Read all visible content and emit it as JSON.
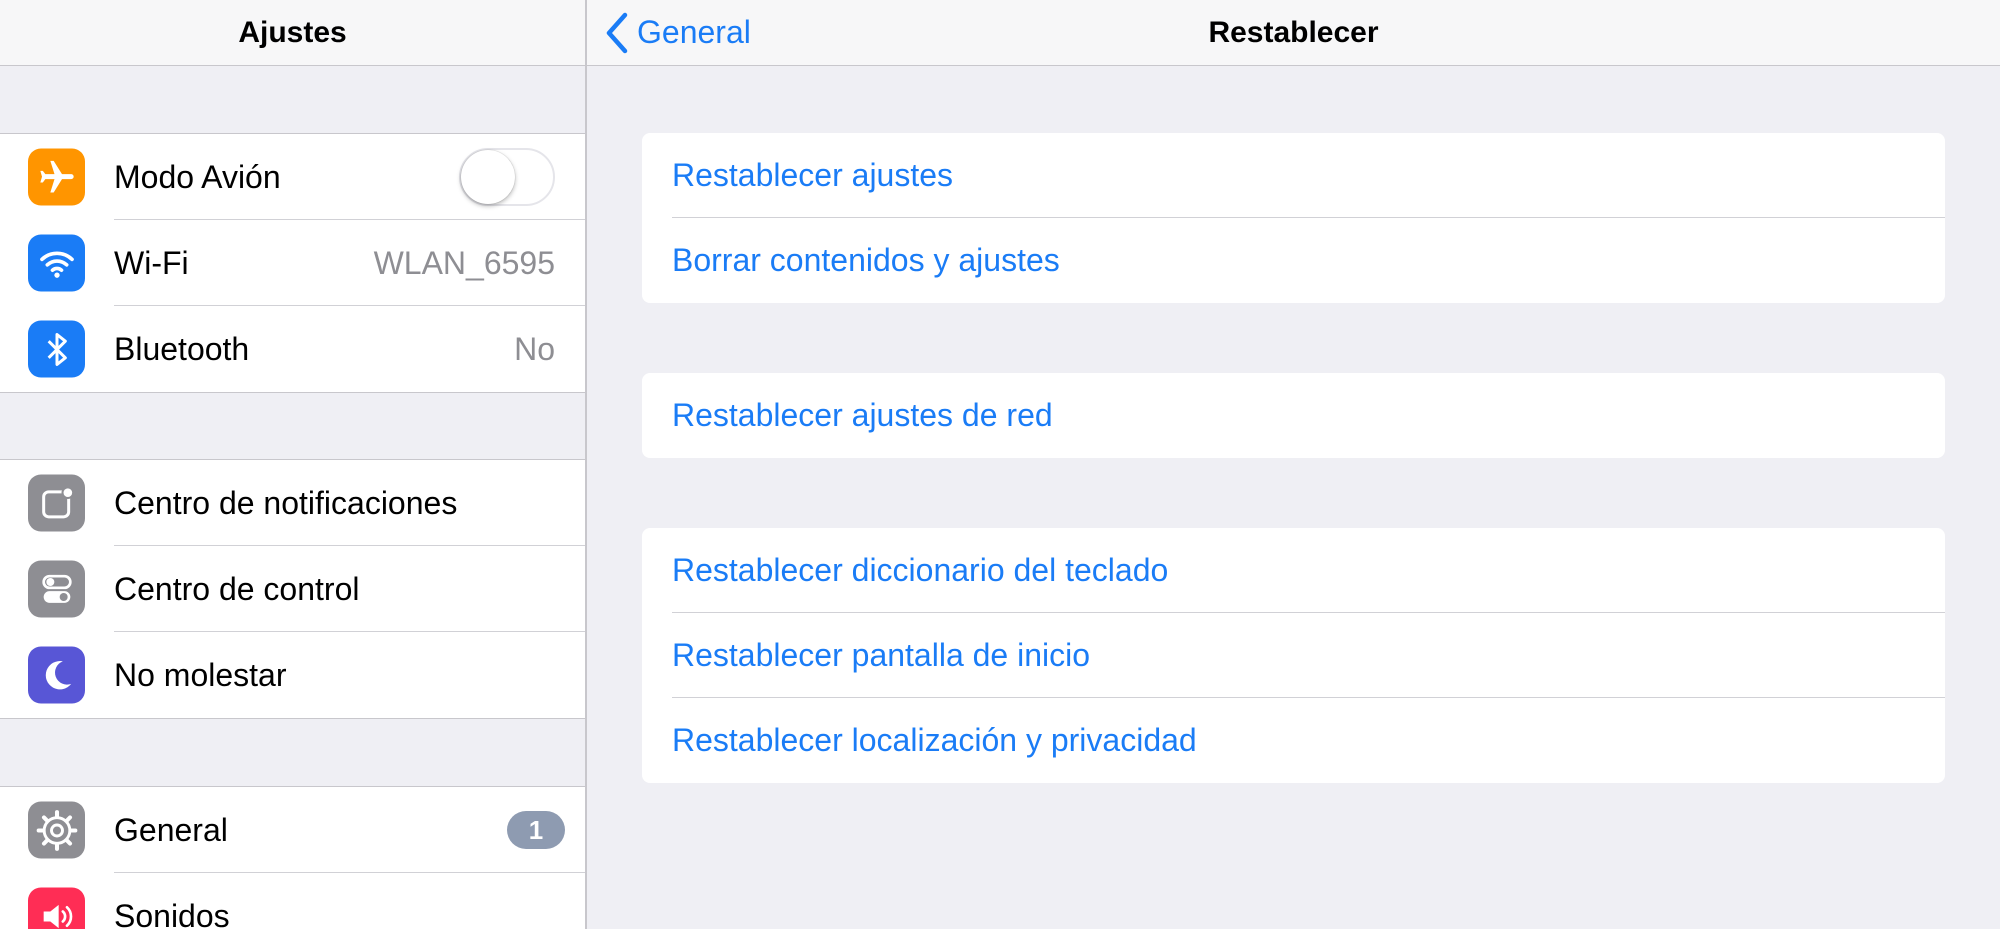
{
  "sidebar": {
    "title": "Ajustes",
    "groups": [
      [
        {
          "label": "Modo Avión",
          "icon": "airplane-icon",
          "color": "#ff9500",
          "toggle": false
        },
        {
          "label": "Wi-Fi",
          "icon": "wifi-icon",
          "color": "#1a7cf6",
          "value": "WLAN_6595"
        },
        {
          "label": "Bluetooth",
          "icon": "bluetooth-icon",
          "color": "#1a7cf6",
          "value": "No"
        }
      ],
      [
        {
          "label": "Centro de notificaciones",
          "icon": "notification-center-icon",
          "color": "#8e8e93"
        },
        {
          "label": "Centro de control",
          "icon": "control-center-icon",
          "color": "#8e8e93"
        },
        {
          "label": "No molestar",
          "icon": "moon-icon",
          "color": "#5856d6"
        }
      ],
      [
        {
          "label": "General",
          "icon": "gear-icon",
          "color": "#8e8e93",
          "badge": "1"
        },
        {
          "label": "Sonidos",
          "icon": "speaker-icon",
          "color": "#ff2d55"
        }
      ]
    ]
  },
  "header": {
    "back_label": "General",
    "title": "Restablecer"
  },
  "reset": {
    "groups": [
      [
        "Restablecer ajustes",
        "Borrar contenidos y ajustes"
      ],
      [
        "Restablecer ajustes de red"
      ],
      [
        "Restablecer diccionario del teclado",
        "Restablecer pantalla de inicio",
        "Restablecer localización y privacidad"
      ]
    ]
  },
  "colors": {
    "accent": "#1a7cf6",
    "background": "#efeff4"
  }
}
